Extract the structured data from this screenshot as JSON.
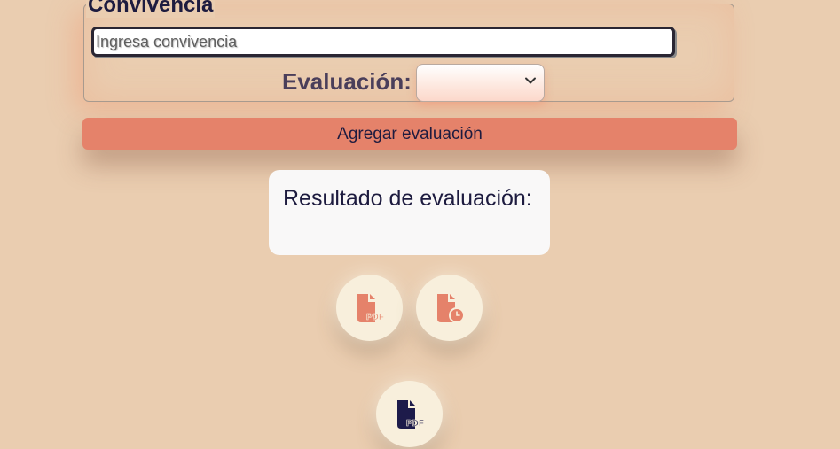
{
  "form": {
    "legend": "Convivencia",
    "input_placeholder": "Ingresa convivencia",
    "input_value": "",
    "evaluation_label": "Evaluación:",
    "evaluation_selected": ""
  },
  "actions": {
    "add_evaluation_label": "Agregar evaluación"
  },
  "result": {
    "title": "Resultado de evaluación:"
  },
  "icon_buttons": [
    {
      "icon": "pdf-file-icon",
      "label": "PDF"
    },
    {
      "icon": "file-clock-icon"
    },
    {
      "icon": "pdf-file-icon",
      "label": "PDF"
    }
  ],
  "colors": {
    "background": "#eacdb0",
    "accent": "#e5826a",
    "text": "#1d1b3f",
    "icon_dark": "#1d1b4a"
  }
}
